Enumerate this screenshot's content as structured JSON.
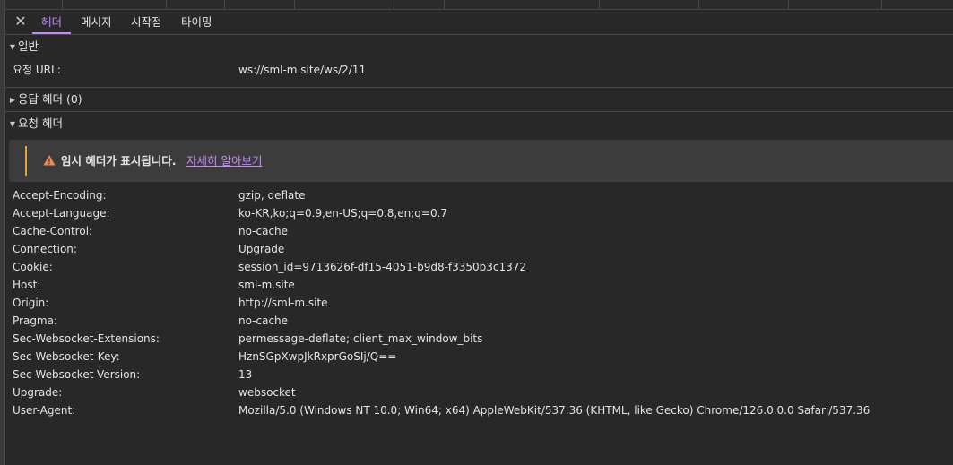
{
  "tabs": [
    "헤더",
    "메시지",
    "시작점",
    "타이밍"
  ],
  "active_tab": "헤더",
  "close_icon": "✕",
  "general": {
    "title": "일반",
    "rows": [
      {
        "key": "요청 URL:",
        "value": "ws://sml-m.site/ws/2/11"
      }
    ]
  },
  "response_headers": {
    "title": "응답 헤더 (0)"
  },
  "request_headers": {
    "title": "요청 헤더",
    "warning": {
      "text": "임시 헤더가 표시됩니다.",
      "link": "자세히 알아보기",
      "accent_color": "#e6a23c"
    },
    "rows": [
      {
        "key": "Accept-Encoding:",
        "value": "gzip, deflate"
      },
      {
        "key": "Accept-Language:",
        "value": "ko-KR,ko;q=0.9,en-US;q=0.8,en;q=0.7"
      },
      {
        "key": "Cache-Control:",
        "value": "no-cache"
      },
      {
        "key": "Connection:",
        "value": "Upgrade"
      },
      {
        "key": "Cookie:",
        "value": "session_id=9713626f-df15-4051-b9d8-f3350b3c1372"
      },
      {
        "key": "Host:",
        "value": "sml-m.site"
      },
      {
        "key": "Origin:",
        "value": "http://sml-m.site"
      },
      {
        "key": "Pragma:",
        "value": "no-cache"
      },
      {
        "key": "Sec-Websocket-Extensions:",
        "value": "permessage-deflate; client_max_window_bits"
      },
      {
        "key": "Sec-Websocket-Key:",
        "value": "HznSGpXwpJkRxprGoSIj/Q=="
      },
      {
        "key": "Sec-Websocket-Version:",
        "value": "13"
      },
      {
        "key": "Upgrade:",
        "value": "websocket"
      },
      {
        "key": "User-Agent:",
        "value": "Mozilla/5.0 (Windows NT 10.0; Win64; x64) AppleWebKit/537.36 (KHTML, like Gecko) Chrome/126.0.0.0 Safari/537.36"
      }
    ]
  },
  "colors": {
    "background": "#282828",
    "accent": "#c58af9",
    "text": "#e3e3e3",
    "warning": "#e6a23c"
  }
}
